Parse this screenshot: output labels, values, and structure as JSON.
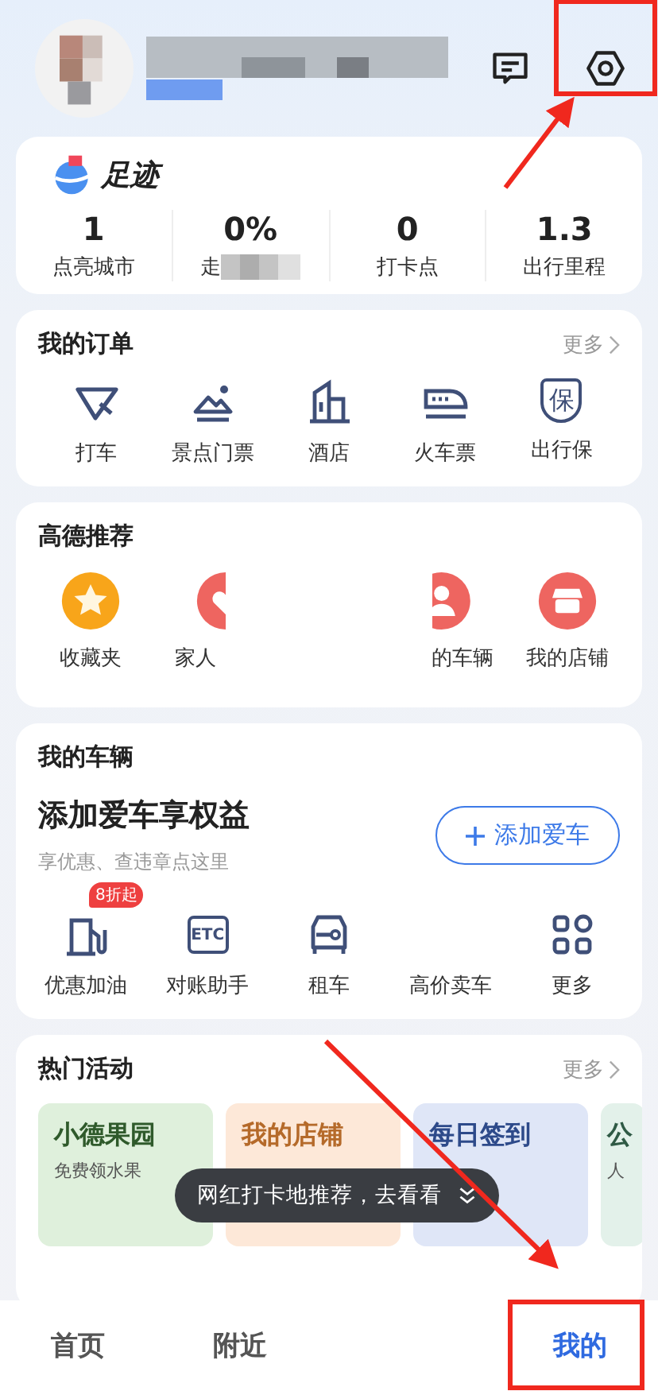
{
  "header": {
    "name_blurred": true
  },
  "footprint": {
    "title": "足迹",
    "stats": [
      {
        "value": "1",
        "label": "点亮城市",
        "blurred": false
      },
      {
        "value": "0%",
        "label": "走",
        "blurred": true
      },
      {
        "value": "0",
        "label": "打卡点",
        "blurred": false
      },
      {
        "value": "1.3",
        "label": "出行里程",
        "blurred": false
      }
    ]
  },
  "orders": {
    "title": "我的订单",
    "more": "更多",
    "items": [
      {
        "label": "打车",
        "kind": "taxi"
      },
      {
        "label": "景点门票",
        "kind": "scenic"
      },
      {
        "label": "酒店",
        "kind": "hotel"
      },
      {
        "label": "火车票",
        "kind": "train"
      },
      {
        "label": "出行保",
        "kind": "insurance",
        "icon_text": "保"
      }
    ]
  },
  "recommend": {
    "title": "高德推荐",
    "items": [
      {
        "label": "收藏夹",
        "kind": "star"
      },
      {
        "label": "家人",
        "kind": "heart"
      },
      {
        "label": "的车辆",
        "kind": "person"
      },
      {
        "label": "我的店铺",
        "kind": "shop"
      }
    ]
  },
  "vehicle": {
    "title": "我的车辆",
    "headline": "添加爱车享权益",
    "subtitle": "享优惠、查违章点这里",
    "button": "添加爱车",
    "tools": [
      {
        "label": "优惠加油",
        "kind": "fuel",
        "badge": "8折起"
      },
      {
        "label": "对账助手",
        "kind": "etc",
        "icon_text": "ETC"
      },
      {
        "label": "租车",
        "kind": "rental"
      },
      {
        "label": "高价卖车",
        "kind": "none"
      },
      {
        "label": "更多",
        "kind": "grid"
      }
    ]
  },
  "activities": {
    "title": "热门活动",
    "more": "更多",
    "cards": [
      {
        "title": "小德果园",
        "subtitle": "免费领水果",
        "kind": "green"
      },
      {
        "title": "我的店铺",
        "kind": "orange"
      },
      {
        "title": "每日签到",
        "kind": "blue"
      },
      {
        "title": "公",
        "subtitle": "人",
        "kind": "teal"
      }
    ]
  },
  "toast": {
    "text": "网红打卡地推荐，去看看"
  },
  "tabbar": [
    {
      "label": "首页",
      "selected": false
    },
    {
      "label": "附近",
      "selected": false
    },
    {
      "label": "我的",
      "selected": true
    }
  ]
}
